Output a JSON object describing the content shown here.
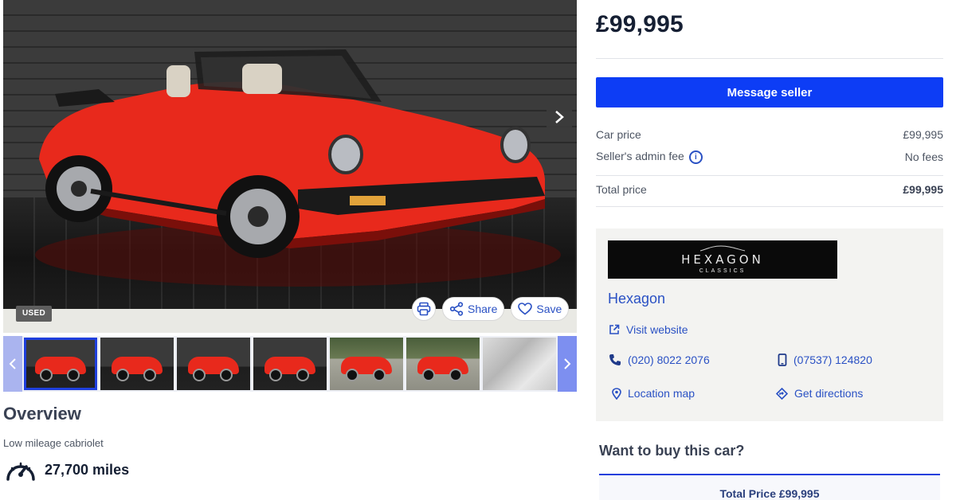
{
  "gallery": {
    "badge": "USED",
    "hero_next_icon": "chevron-right-icon",
    "actions": {
      "print_icon": "print-icon",
      "share_label": "Share",
      "save_label": "Save"
    },
    "thumbnails": [
      {
        "kind": "studio",
        "active": true
      },
      {
        "kind": "studio",
        "active": false
      },
      {
        "kind": "studio",
        "active": false
      },
      {
        "kind": "studio",
        "active": false
      },
      {
        "kind": "outdoor",
        "active": false
      },
      {
        "kind": "outdoor",
        "active": false
      },
      {
        "kind": "interior",
        "active": false
      }
    ]
  },
  "overview": {
    "title": "Overview",
    "subtitle": "Low mileage cabriolet",
    "mileage": "27,700 miles"
  },
  "pricing": {
    "headline_price": "£99,995",
    "message_button": "Message seller",
    "car_price_label": "Car price",
    "car_price_value": "£99,995",
    "admin_fee_label": "Seller's admin fee",
    "admin_fee_value": "No fees",
    "total_label": "Total price",
    "total_value": "£99,995"
  },
  "dealer": {
    "logo_line1": "HEXAGON",
    "logo_line2": "CLASSICS",
    "name": "Hexagon",
    "website_label": "Visit website",
    "phone_landline": "(020) 8022 2076",
    "phone_mobile": "(07537) 124820",
    "location_label": "Location map",
    "directions_label": "Get directions"
  },
  "buy": {
    "title": "Want to buy this car?",
    "total_price_label": "Total Price £99,995"
  },
  "colors": {
    "accent_blue": "#0d3df5",
    "link_blue": "#2a51c4",
    "car_red": "#e8291c"
  }
}
